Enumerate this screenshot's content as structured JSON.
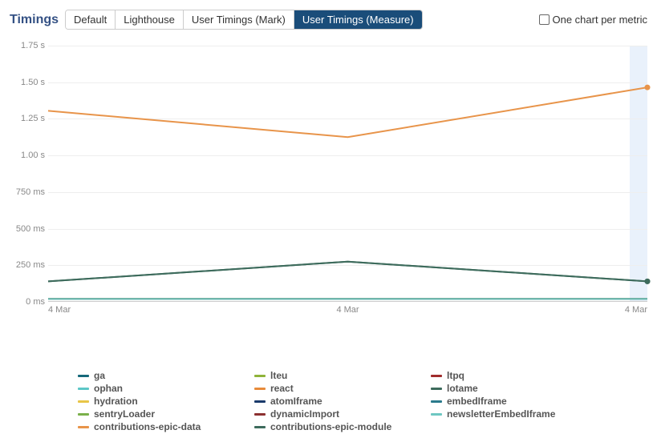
{
  "title": "Timings",
  "tabs": [
    {
      "label": "Default",
      "active": false
    },
    {
      "label": "Lighthouse",
      "active": false
    },
    {
      "label": "User Timings (Mark)",
      "active": false
    },
    {
      "label": "User Timings (Measure)",
      "active": true
    }
  ],
  "checkbox": {
    "label": "One chart per metric",
    "checked": false
  },
  "chart_data": {
    "type": "line",
    "title": "",
    "xlabel": "",
    "ylabel": "",
    "ylim": [
      0,
      1750
    ],
    "y_ticks": [
      {
        "value": 0,
        "label": "0 ms"
      },
      {
        "value": 250,
        "label": "250 ms"
      },
      {
        "value": 500,
        "label": "500 ms"
      },
      {
        "value": 750,
        "label": "750 ms"
      },
      {
        "value": 1000,
        "label": "1.00 s"
      },
      {
        "value": 1250,
        "label": "1.25 s"
      },
      {
        "value": 1500,
        "label": "1.50 s"
      },
      {
        "value": 1750,
        "label": "1.75 s"
      }
    ],
    "categories": [
      "4 Mar",
      "4 Mar",
      "4 Mar"
    ],
    "series": [
      {
        "name": "ga",
        "color": "#16697a",
        "values": [
          20,
          20,
          20
        ]
      },
      {
        "name": "lteu",
        "color": "#8fb339",
        "values": [
          20,
          20,
          20
        ]
      },
      {
        "name": "ltpq",
        "color": "#a02c2c",
        "values": [
          20,
          20,
          20
        ]
      },
      {
        "name": "ophan",
        "color": "#5cc7c7",
        "values": [
          20,
          20,
          20
        ]
      },
      {
        "name": "react",
        "color": "#e88b3a",
        "values": [
          20,
          20,
          20
        ]
      },
      {
        "name": "lotame",
        "color": "#3d6b5c",
        "values": [
          140,
          275,
          140
        ]
      },
      {
        "name": "hydration",
        "color": "#e8c547",
        "values": [
          20,
          20,
          20
        ]
      },
      {
        "name": "atomIframe",
        "color": "#1a3a6b",
        "values": [
          20,
          20,
          20
        ]
      },
      {
        "name": "embedIframe",
        "color": "#2a7a8c",
        "values": [
          20,
          20,
          20
        ]
      },
      {
        "name": "sentryLoader",
        "color": "#7ab04a",
        "values": [
          20,
          20,
          20
        ]
      },
      {
        "name": "dynamicImport",
        "color": "#8c3030",
        "values": [
          20,
          20,
          20
        ]
      },
      {
        "name": "newsletterEmbedIframe",
        "color": "#6ec7c2",
        "values": [
          20,
          20,
          20
        ]
      },
      {
        "name": "contributions-epic-data",
        "color": "#e8944a",
        "values": [
          1305,
          1125,
          1465
        ]
      },
      {
        "name": "contributions-epic-module",
        "color": "#3d6b5c",
        "values": [
          140,
          275,
          140
        ]
      }
    ]
  }
}
